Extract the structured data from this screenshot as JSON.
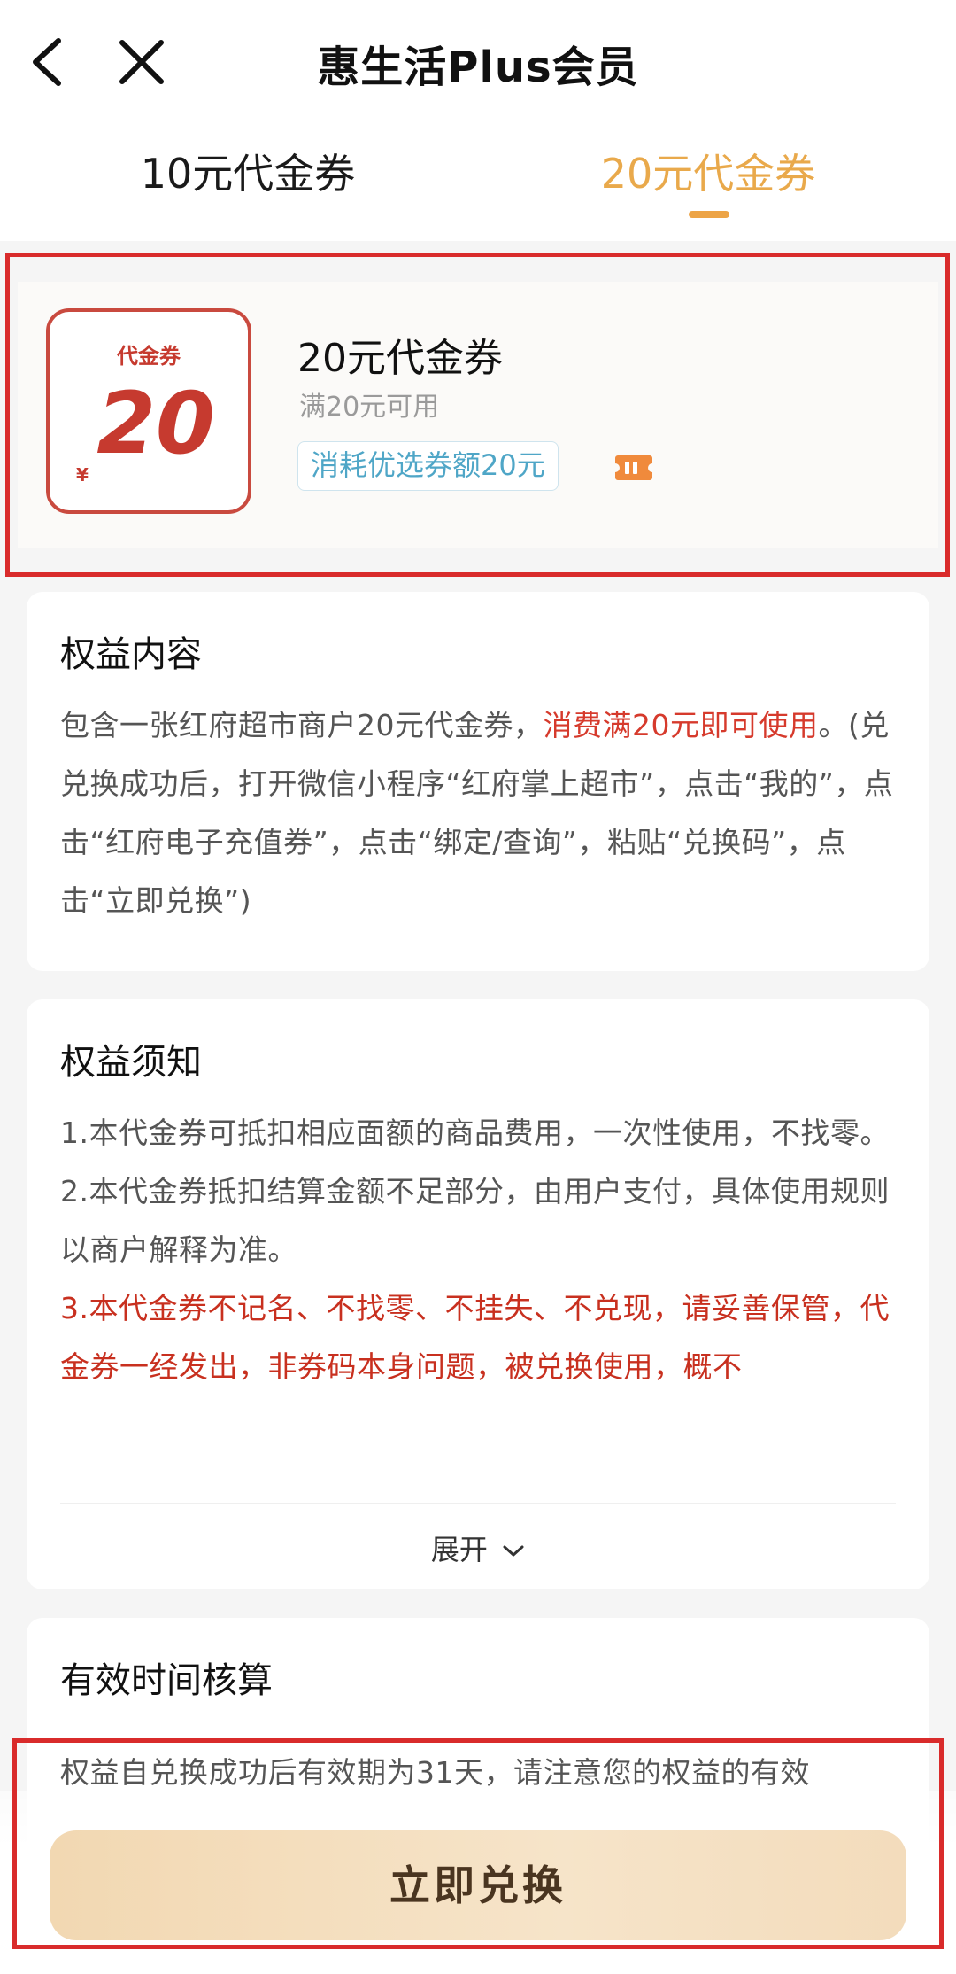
{
  "header": {
    "title": "惠生活Plus会员"
  },
  "tabs": [
    {
      "label": "10元代金券",
      "active": false
    },
    {
      "label": "20元代金券",
      "active": true
    }
  ],
  "coupon": {
    "face_label": "代金券",
    "currency": "¥",
    "face_value": "20",
    "name": "20元代金券",
    "condition": "满20元可用",
    "tag": "消耗优选券额20元"
  },
  "rights_content": {
    "title": "权益内容",
    "text_before": "包含一张红府超市商户20元代金券，",
    "text_highlight": "消费满20元即可使用",
    "text_after": "。(兑兑换成功后，打开微信小程序“红府掌上超市”，点击“我的”，点击“红府电子充值券”，点击“绑定/查询”，粘贴“兑换码”，点击“立即兑换”)"
  },
  "rights_notice": {
    "title": "权益须知",
    "items": [
      "1.本代金券可抵扣相应面额的商品费用，一次性使用，不找零。",
      "2.本代金券抵扣结算金额不足部分，由用户支付，具体使用规则以商户解释为准。",
      "3.本代金券不记名、不找零、不挂失、不兑现，请妥善保管，代金券一经发出，非券码本身问题，被兑换使用，概不"
    ],
    "expand_label": "展开"
  },
  "validity": {
    "title": "有效时间核算",
    "text": "权益自兑换成功后有效期为31天，请注意您的权益的有效"
  },
  "actions": {
    "redeem_label": "立即兑换"
  },
  "colors": {
    "accent_orange": "#eda446",
    "coupon_red": "#c63a2f",
    "highlight_red": "#d63a2c",
    "tag_blue": "#4fa6c7",
    "button_bg": "#f2d8b2"
  }
}
